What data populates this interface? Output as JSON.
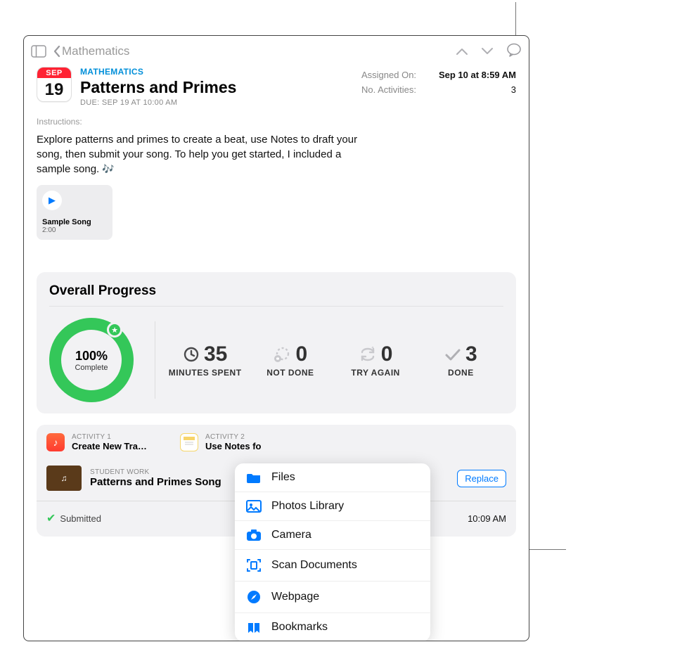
{
  "nav": {
    "back_label": "Mathematics"
  },
  "header": {
    "calendar_month": "SEP",
    "calendar_day": "19",
    "subject": "MATHEMATICS",
    "title": "Patterns and Primes",
    "due": "DUE: SEP 19 AT 10:00 AM"
  },
  "meta": {
    "assigned_label": "Assigned On:",
    "assigned_value": "Sep 10 at 8:59 AM",
    "activities_label": "No. Activities:",
    "activities_value": "3"
  },
  "instructions": {
    "label": "Instructions:",
    "body": "Explore patterns and primes to create a beat, use Notes to draft your song, then submit your song. To help you get started, I included a sample song. "
  },
  "sample": {
    "title": "Sample Song",
    "duration": "2:00"
  },
  "progress": {
    "title": "Overall Progress",
    "percent": "100%",
    "percent_sub": "Complete",
    "minutes_num": "35",
    "minutes_label": "MINUTES SPENT",
    "notdone_num": "0",
    "notdone_label": "NOT DONE",
    "tryagain_num": "0",
    "tryagain_label": "TRY AGAIN",
    "done_num": "3",
    "done_label": "DONE"
  },
  "activities": {
    "a1_label": "ACTIVITY 1",
    "a1_name": "Create New Tra…",
    "a2_label": "ACTIVITY 2",
    "a2_name": "Use Notes fo"
  },
  "work": {
    "label": "STUDENT WORK",
    "name": "Patterns and Primes Song",
    "replace": "Replace"
  },
  "submitted": {
    "label": "Submitted",
    "time": "10:09 AM"
  },
  "menu": {
    "files": "Files",
    "photos": "Photos Library",
    "camera": "Camera",
    "scan": "Scan Documents",
    "webpage": "Webpage",
    "bookmarks": "Bookmarks"
  }
}
